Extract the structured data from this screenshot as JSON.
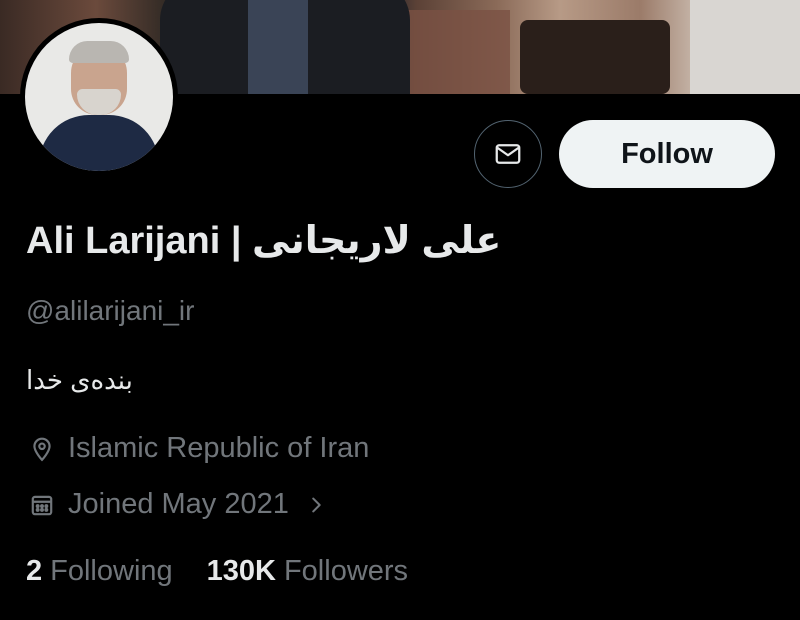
{
  "profile": {
    "display_name": "Ali Larijani | علی لاریجانی",
    "handle": "@alilarijani_ir",
    "bio": "بنده‌ی خدا",
    "location": "Islamic Republic of Iran",
    "joined": "Joined May 2021",
    "following_count": "2",
    "following_label": "Following",
    "followers_count": "130K",
    "followers_label": "Followers"
  },
  "actions": {
    "follow_label": "Follow"
  },
  "icons": {
    "message": "mail-icon",
    "location": "location-pin-icon",
    "joined": "calendar-icon",
    "chevron": "chevron-right-icon"
  },
  "colors": {
    "background": "#000000",
    "primary_text": "#e7e9ea",
    "secondary_text": "#71767b",
    "follow_button_bg": "#eff3f4",
    "border": "#536471"
  }
}
